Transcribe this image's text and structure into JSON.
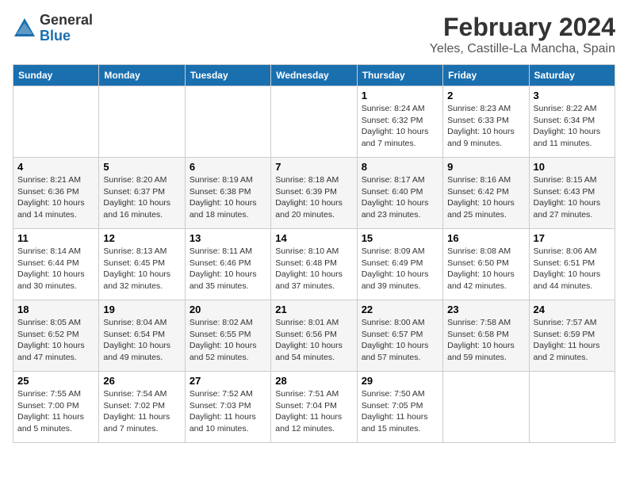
{
  "logo": {
    "general": "General",
    "blue": "Blue"
  },
  "title": "February 2024",
  "subtitle": "Yeles, Castille-La Mancha, Spain",
  "headers": [
    "Sunday",
    "Monday",
    "Tuesday",
    "Wednesday",
    "Thursday",
    "Friday",
    "Saturday"
  ],
  "weeks": [
    [
      {
        "day": "",
        "text": ""
      },
      {
        "day": "",
        "text": ""
      },
      {
        "day": "",
        "text": ""
      },
      {
        "day": "",
        "text": ""
      },
      {
        "day": "1",
        "text": "Sunrise: 8:24 AM\nSunset: 6:32 PM\nDaylight: 10 hours\nand 7 minutes."
      },
      {
        "day": "2",
        "text": "Sunrise: 8:23 AM\nSunset: 6:33 PM\nDaylight: 10 hours\nand 9 minutes."
      },
      {
        "day": "3",
        "text": "Sunrise: 8:22 AM\nSunset: 6:34 PM\nDaylight: 10 hours\nand 11 minutes."
      }
    ],
    [
      {
        "day": "4",
        "text": "Sunrise: 8:21 AM\nSunset: 6:36 PM\nDaylight: 10 hours\nand 14 minutes."
      },
      {
        "day": "5",
        "text": "Sunrise: 8:20 AM\nSunset: 6:37 PM\nDaylight: 10 hours\nand 16 minutes."
      },
      {
        "day": "6",
        "text": "Sunrise: 8:19 AM\nSunset: 6:38 PM\nDaylight: 10 hours\nand 18 minutes."
      },
      {
        "day": "7",
        "text": "Sunrise: 8:18 AM\nSunset: 6:39 PM\nDaylight: 10 hours\nand 20 minutes."
      },
      {
        "day": "8",
        "text": "Sunrise: 8:17 AM\nSunset: 6:40 PM\nDaylight: 10 hours\nand 23 minutes."
      },
      {
        "day": "9",
        "text": "Sunrise: 8:16 AM\nSunset: 6:42 PM\nDaylight: 10 hours\nand 25 minutes."
      },
      {
        "day": "10",
        "text": "Sunrise: 8:15 AM\nSunset: 6:43 PM\nDaylight: 10 hours\nand 27 minutes."
      }
    ],
    [
      {
        "day": "11",
        "text": "Sunrise: 8:14 AM\nSunset: 6:44 PM\nDaylight: 10 hours\nand 30 minutes."
      },
      {
        "day": "12",
        "text": "Sunrise: 8:13 AM\nSunset: 6:45 PM\nDaylight: 10 hours\nand 32 minutes."
      },
      {
        "day": "13",
        "text": "Sunrise: 8:11 AM\nSunset: 6:46 PM\nDaylight: 10 hours\nand 35 minutes."
      },
      {
        "day": "14",
        "text": "Sunrise: 8:10 AM\nSunset: 6:48 PM\nDaylight: 10 hours\nand 37 minutes."
      },
      {
        "day": "15",
        "text": "Sunrise: 8:09 AM\nSunset: 6:49 PM\nDaylight: 10 hours\nand 39 minutes."
      },
      {
        "day": "16",
        "text": "Sunrise: 8:08 AM\nSunset: 6:50 PM\nDaylight: 10 hours\nand 42 minutes."
      },
      {
        "day": "17",
        "text": "Sunrise: 8:06 AM\nSunset: 6:51 PM\nDaylight: 10 hours\nand 44 minutes."
      }
    ],
    [
      {
        "day": "18",
        "text": "Sunrise: 8:05 AM\nSunset: 6:52 PM\nDaylight: 10 hours\nand 47 minutes."
      },
      {
        "day": "19",
        "text": "Sunrise: 8:04 AM\nSunset: 6:54 PM\nDaylight: 10 hours\nand 49 minutes."
      },
      {
        "day": "20",
        "text": "Sunrise: 8:02 AM\nSunset: 6:55 PM\nDaylight: 10 hours\nand 52 minutes."
      },
      {
        "day": "21",
        "text": "Sunrise: 8:01 AM\nSunset: 6:56 PM\nDaylight: 10 hours\nand 54 minutes."
      },
      {
        "day": "22",
        "text": "Sunrise: 8:00 AM\nSunset: 6:57 PM\nDaylight: 10 hours\nand 57 minutes."
      },
      {
        "day": "23",
        "text": "Sunrise: 7:58 AM\nSunset: 6:58 PM\nDaylight: 10 hours\nand 59 minutes."
      },
      {
        "day": "24",
        "text": "Sunrise: 7:57 AM\nSunset: 6:59 PM\nDaylight: 11 hours\nand 2 minutes."
      }
    ],
    [
      {
        "day": "25",
        "text": "Sunrise: 7:55 AM\nSunset: 7:00 PM\nDaylight: 11 hours\nand 5 minutes."
      },
      {
        "day": "26",
        "text": "Sunrise: 7:54 AM\nSunset: 7:02 PM\nDaylight: 11 hours\nand 7 minutes."
      },
      {
        "day": "27",
        "text": "Sunrise: 7:52 AM\nSunset: 7:03 PM\nDaylight: 11 hours\nand 10 minutes."
      },
      {
        "day": "28",
        "text": "Sunrise: 7:51 AM\nSunset: 7:04 PM\nDaylight: 11 hours\nand 12 minutes."
      },
      {
        "day": "29",
        "text": "Sunrise: 7:50 AM\nSunset: 7:05 PM\nDaylight: 11 hours\nand 15 minutes."
      },
      {
        "day": "",
        "text": ""
      },
      {
        "day": "",
        "text": ""
      }
    ]
  ]
}
